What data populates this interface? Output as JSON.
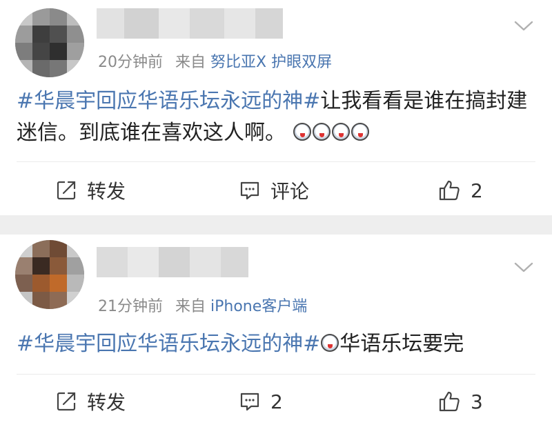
{
  "posts": [
    {
      "time": "20分钟前",
      "from_label": "来自",
      "source": "努比亚X 护眼双屏",
      "topic": "#华晨宇回应华语乐坛永远的神#",
      "text": "让我看看是谁在搞封建迷信。到底谁在喜欢这人啊。",
      "emoji_count": 4,
      "repost_label": "转发",
      "comment_label": "评论",
      "like_count": "2"
    },
    {
      "time": "21分钟前",
      "from_label": "来自",
      "source": "iPhone客户端",
      "topic": "#华晨宇回应华语乐坛永远的神#",
      "text": "华语乐坛要完",
      "emoji_count": 1,
      "repost_label": "转发",
      "comment_count": "2",
      "like_count": "3"
    }
  ],
  "icons": {
    "more": "chevron-down-icon",
    "repost": "repost-icon",
    "comment": "comment-icon",
    "like": "thumbs-up-icon",
    "emoji": "laughing-emoji-icon"
  },
  "colors": {
    "link": "#4a76b0",
    "meta": "#8a8a8a",
    "separator": "#eeeeee"
  }
}
